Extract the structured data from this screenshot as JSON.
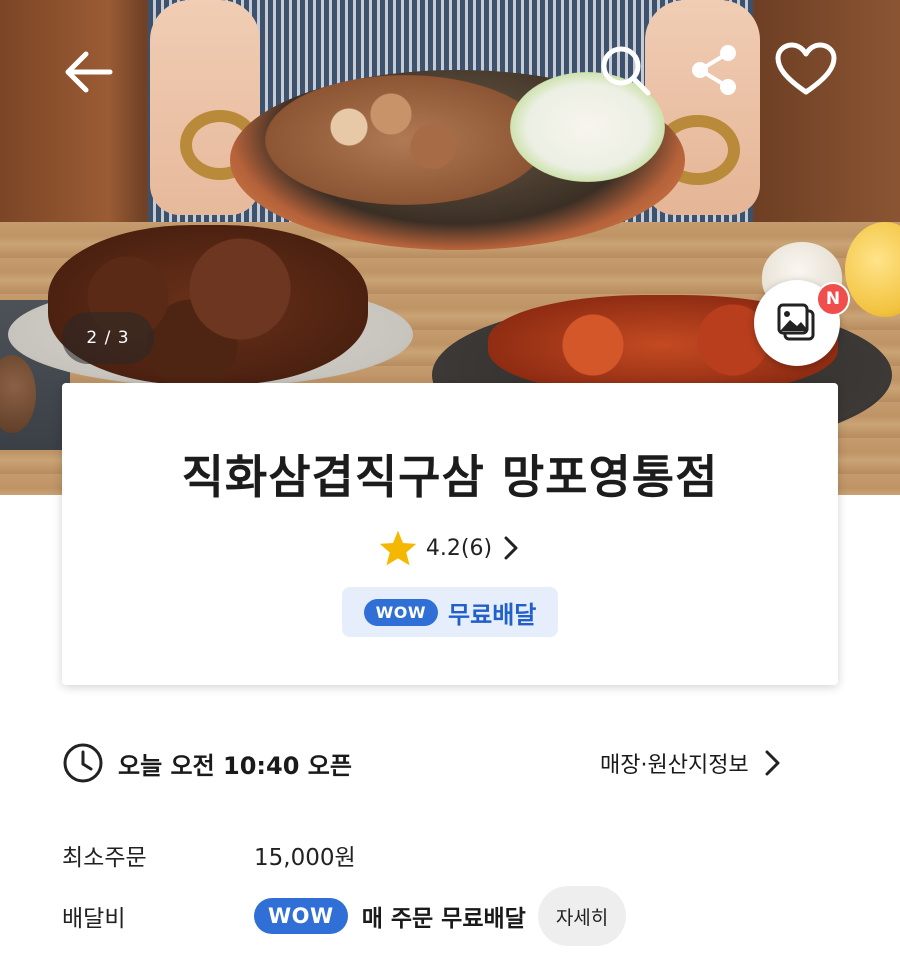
{
  "hero": {
    "page_counter": "2 / 3",
    "new_badge": "N",
    "icons": [
      "back-arrow-icon",
      "search-icon",
      "share-icon",
      "heart-icon",
      "photo-review-icon"
    ]
  },
  "store": {
    "name": "직화삼겹직구삼 망포영통점",
    "rating": "4.2(6)",
    "wow_label": "WOW",
    "delivery_tag": "무료배달"
  },
  "hours": {
    "text": "오늘 오전 10:40 오픈",
    "store_info_label": "매장·원산지정보"
  },
  "details": {
    "min_order_label": "최소주문",
    "min_order_value": "15,000원",
    "delivery_fee_label": "배달비",
    "wow_label": "WOW",
    "delivery_fee_text": "매 주문 무료배달",
    "detail_button": "자세히"
  },
  "colors": {
    "wow_blue": "#2f6fd6",
    "pill_bg": "#e6eefb",
    "star": "#f5b800",
    "badge_red": "#f04d4d"
  }
}
